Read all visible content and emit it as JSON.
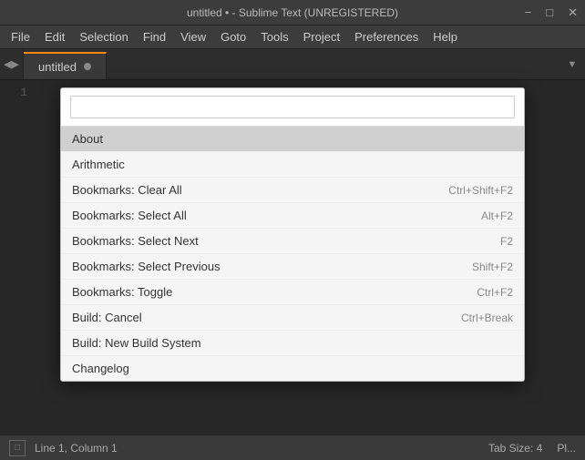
{
  "titleBar": {
    "title": "untitled • - Sublime Text (UNREGISTERED)",
    "controls": [
      "−",
      "□",
      "✕"
    ]
  },
  "menuBar": {
    "items": [
      "File",
      "Edit",
      "Selection",
      "Find",
      "View",
      "Goto",
      "Tools",
      "Project",
      "Preferences",
      "Help"
    ]
  },
  "tabBar": {
    "activeTab": "untitled",
    "navLeft": "◀",
    "navRight": "▶",
    "dropdownArrow": "▼"
  },
  "commandPalette": {
    "searchPlaceholder": "",
    "searchValue": "",
    "items": [
      {
        "label": "About",
        "shortcut": "",
        "selected": true
      },
      {
        "label": "Arithmetic",
        "shortcut": ""
      },
      {
        "label": "Bookmarks: Clear All",
        "shortcut": "Ctrl+Shift+F2"
      },
      {
        "label": "Bookmarks: Select All",
        "shortcut": "Alt+F2"
      },
      {
        "label": "Bookmarks: Select Next",
        "shortcut": "F2"
      },
      {
        "label": "Bookmarks: Select Previous",
        "shortcut": "Shift+F2"
      },
      {
        "label": "Bookmarks: Toggle",
        "shortcut": "Ctrl+F2"
      },
      {
        "label": "Build: Cancel",
        "shortcut": "Ctrl+Break"
      },
      {
        "label": "Build: New Build System",
        "shortcut": ""
      },
      {
        "label": "Changelog",
        "shortcut": ""
      }
    ]
  },
  "lineNumbers": [
    "1"
  ],
  "statusBar": {
    "position": "Line 1, Column 1",
    "tabSize": "Tab Size: 4",
    "encoding": "Pl..."
  }
}
